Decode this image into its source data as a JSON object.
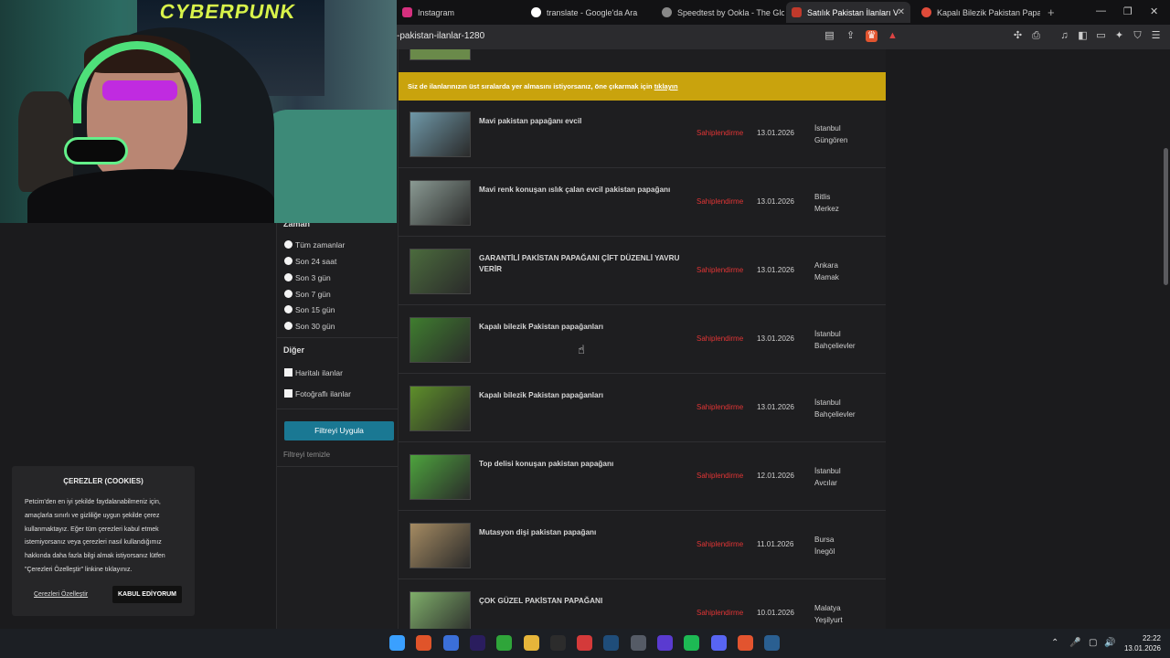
{
  "browser": {
    "tabs": [
      {
        "label": "Instagram",
        "icon": "instagram-icon",
        "color": "#d6307f"
      },
      {
        "label": "translate - Google'da Ara",
        "icon": "google-icon",
        "color": "#ffffff"
      },
      {
        "label": "Speedtest by Ookla - The Glob",
        "icon": "speedtest-icon",
        "color": "#cccccc"
      },
      {
        "label": "Satılık Pakistan İlanları Ve F",
        "icon": "petcim-icon",
        "color": "#c0392b"
      },
      {
        "label": "Kapalı Bilezik Pakistan Papağan",
        "icon": "search-icon",
        "color": "#e04b3a"
      }
    ],
    "url": "-pakistan-ilanlar-1280"
  },
  "sidebar": {
    "zaman_heading": "Zaman",
    "time_options": [
      "Tüm zamanlar",
      "Son 24 saat",
      "Son 3 gün",
      "Son 7 gün",
      "Son 15 gün",
      "Son 30 gün"
    ],
    "other_heading": "Diğer",
    "checks": [
      "Haritalı ilanlar",
      "Fotoğraflı ilanlar"
    ],
    "apply_label": "Filtreyi Uygula",
    "clear_label": "Filtreyi temizle"
  },
  "banner": {
    "text": "Siz de ilanlarınızın üst sıralarda yer almasını istiyorsanız, öne çıkarmak için",
    "link": "tıklayın"
  },
  "listings": [
    {
      "title": "Mavi pakistan papağanı evcil",
      "owner": "Sahiplendirme",
      "date": "13.01.2026",
      "city": "İstanbul",
      "district": "Güngören",
      "thumb": "#6f98a8"
    },
    {
      "title": "Mavi renk konuşan ıslık çalan evcil pakistan papağanı",
      "owner": "Sahiplendirme",
      "date": "13.01.2026",
      "city": "Bitlis",
      "district": "Merkez",
      "thumb": "#8a9a93"
    },
    {
      "title": "GARANTİLİ PAKİSTAN PAPAĞANI ÇİFT DÜZENLİ YAVRU VERİR",
      "owner": "Sahiplendirme",
      "date": "13.01.2026",
      "city": "Ankara",
      "district": "Mamak",
      "thumb": "#4b6b3d"
    },
    {
      "title": "Kapalı bilezik Pakistan papağanları",
      "owner": "Sahiplendirme",
      "date": "13.01.2026",
      "city": "İstanbul",
      "district": "Bahçelievler",
      "thumb": "#3f7d2f"
    },
    {
      "title": "Kapalı bilezik Pakistan papağanları",
      "owner": "Sahiplendirme",
      "date": "13.01.2026",
      "city": "İstanbul",
      "district": "Bahçelievler",
      "thumb": "#5e8f2a"
    },
    {
      "title": "Top delisi konuşan pakistan papağanı",
      "owner": "Sahiplendirme",
      "date": "12.01.2026",
      "city": "İstanbul",
      "district": "Avcılar",
      "thumb": "#4da33d"
    },
    {
      "title": "Mutasyon dişi pakistan papağanı",
      "owner": "Sahiplendirme",
      "date": "11.01.2026",
      "city": "Bursa",
      "district": "İnegöl",
      "thumb": "#a58b62"
    },
    {
      "title": "ÇOK GÜZEL PAKİSTAN PAPAĞANI",
      "owner": "Sahiplendirme",
      "date": "10.01.2026",
      "city": "Malatya",
      "district": "Yeşilyurt",
      "thumb": "#7fae6a"
    }
  ],
  "cookie": {
    "title": "ÇEREZLER (COOKIES)",
    "body": "Petcim'den en iyi şekilde faydalanabilmeniz için, amaçlarla sınırlı ve gizliliğe uygun şekilde çerez kullanmaktayız. Eğer tüm çerezleri kabul etmek istemiyorsanız veya çerezleri nasıl kullandığımız hakkında daha fazla bilgi almak istiyorsanız lütfen \"Çerezleri Özelleştir\" linkine tıklayınız.",
    "customize": "Çerezleri Özelleştir",
    "accept": "KABUL EDİYORUM"
  },
  "webcam": {
    "poster_text": "CYBERPUNK"
  },
  "taskbar": {
    "apps": [
      {
        "name": "windows-start-icon",
        "color": "#3aa0ff"
      },
      {
        "name": "app-orange-icon",
        "color": "#e0542a"
      },
      {
        "name": "app-blue-icon",
        "color": "#3b6fd8"
      },
      {
        "name": "premiere-icon",
        "color": "#2a1d5e"
      },
      {
        "name": "xbox-icon",
        "color": "#2fa53a"
      },
      {
        "name": "file-explorer-icon",
        "color": "#e6b53a"
      },
      {
        "name": "epic-games-icon",
        "color": "#2c2c2c"
      },
      {
        "name": "app-red-icon",
        "color": "#d43a3a"
      },
      {
        "name": "steam-icon",
        "color": "#1f4d7a"
      },
      {
        "name": "app-gray-icon",
        "color": "#555b66"
      },
      {
        "name": "app-purple-icon",
        "color": "#5a3bd0"
      },
      {
        "name": "spotify-icon",
        "color": "#1db954"
      },
      {
        "name": "discord-icon",
        "color": "#5865f2"
      },
      {
        "name": "brave-icon",
        "color": "#e2542f"
      },
      {
        "name": "steam2-icon",
        "color": "#2a5f91"
      }
    ],
    "time": "22:22",
    "date": "13.01.2026"
  }
}
